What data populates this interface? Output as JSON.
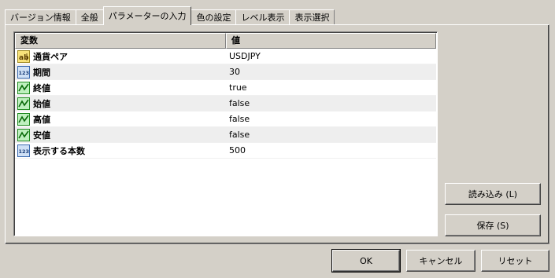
{
  "tabs": [
    {
      "label": "バージョン情報"
    },
    {
      "label": "全般"
    },
    {
      "label": "パラメーターの入力"
    },
    {
      "label": "色の設定"
    },
    {
      "label": "レベル表示"
    },
    {
      "label": "表示選択"
    }
  ],
  "grid": {
    "col_variable": "変数",
    "col_value": "値",
    "rows": [
      {
        "icon": "string-type-icon",
        "name": "通貨ペア",
        "value": "USDJPY"
      },
      {
        "icon": "integer-type-icon",
        "name": "期間",
        "value": "30"
      },
      {
        "icon": "boolean-type-icon",
        "name": "終値",
        "value": "true"
      },
      {
        "icon": "boolean-type-icon",
        "name": "始値",
        "value": "false"
      },
      {
        "icon": "boolean-type-icon",
        "name": "高値",
        "value": "false"
      },
      {
        "icon": "boolean-type-icon",
        "name": "安値",
        "value": "false"
      },
      {
        "icon": "integer-type-icon",
        "name": "表示する本数",
        "value": "500"
      }
    ]
  },
  "buttons": {
    "load": "読み込み (L)",
    "save": "保存 (S)",
    "ok": "OK",
    "cancel": "キャンセル",
    "reset": "リセット"
  }
}
